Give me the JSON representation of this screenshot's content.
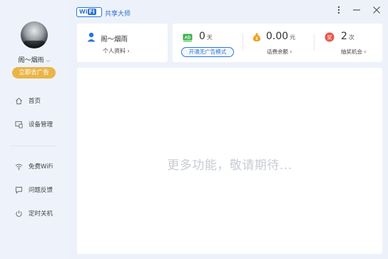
{
  "app": {
    "logo_text": "Wi",
    "logo_text2": "Fi",
    "title": "共享大师"
  },
  "window_controls": {
    "menu_icon": "more-vertical-icon",
    "minimize_icon": "minimize-icon",
    "close_icon": "close-icon"
  },
  "sidebar": {
    "username": "阁～烟雨",
    "ad_button": "立即去广告",
    "items": [
      {
        "label": "首页",
        "icon": "home-icon"
      },
      {
        "label": "设备管理",
        "icon": "device-icon"
      },
      {
        "label": "免费WiFi",
        "icon": "wifi-icon"
      },
      {
        "label": "问题反馈",
        "icon": "feedback-icon"
      },
      {
        "label": "定时关机",
        "icon": "power-icon"
      }
    ]
  },
  "user_card": {
    "name": "阁～烟雨",
    "link": "个人资料 ›"
  },
  "stats": {
    "noad": {
      "value": "0",
      "unit": "天",
      "button": "开通无广告模式"
    },
    "balance": {
      "value": "0.00",
      "unit": "元",
      "link": "话费余额 ›"
    },
    "lottery": {
      "value": "2",
      "unit": "次",
      "link": "抽奖机会 ›"
    }
  },
  "main": {
    "placeholder": "更多功能，敬请期待..."
  },
  "colors": {
    "accent": "#2a73d9",
    "ad_button": "#e9b548",
    "noad_icon": "#3db14a",
    "balance_icon": "#f0a020",
    "lottery_icon": "#e8564a"
  }
}
